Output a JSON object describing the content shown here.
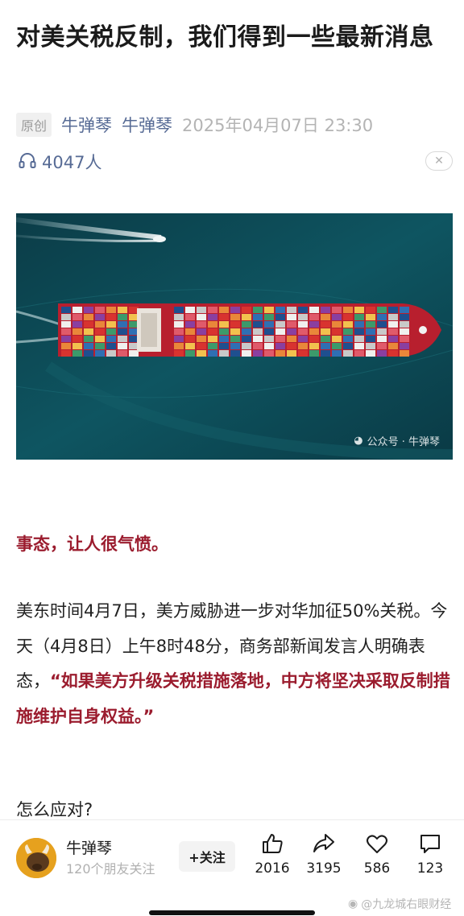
{
  "article": {
    "title": "对美关税反制，我们得到一些最新消息",
    "badge": "原创",
    "account": "牛弹琴",
    "author": "牛弹琴",
    "datetime": "2025年04月07日 23:30",
    "listeners": "4047人",
    "image_watermark": "公众号 · 牛弹琴",
    "lead": "事态，让人很气愤。",
    "paragraph_before_quote": "美东时间4月7日，美方威胁进一步对华加征50%关税。今天（4月8日）上午8时48分，商务部新闻发言人明确表态，",
    "paragraph_quote": "“如果美方升级关税措施落地，中方将坚决采取反制措施维护自身权益。”",
    "question": "怎么应对?"
  },
  "bottom_bar": {
    "account_name": "牛弹琴",
    "followers": "120个朋友关注",
    "follow_label": "+关注",
    "like_count": "2016",
    "share_count": "3195",
    "favorite_count": "586",
    "comment_count": "123"
  },
  "watermark": "@九龙城右眼财经",
  "colors": {
    "accent_red": "#9b1c2e",
    "link_blue": "#576b95"
  }
}
